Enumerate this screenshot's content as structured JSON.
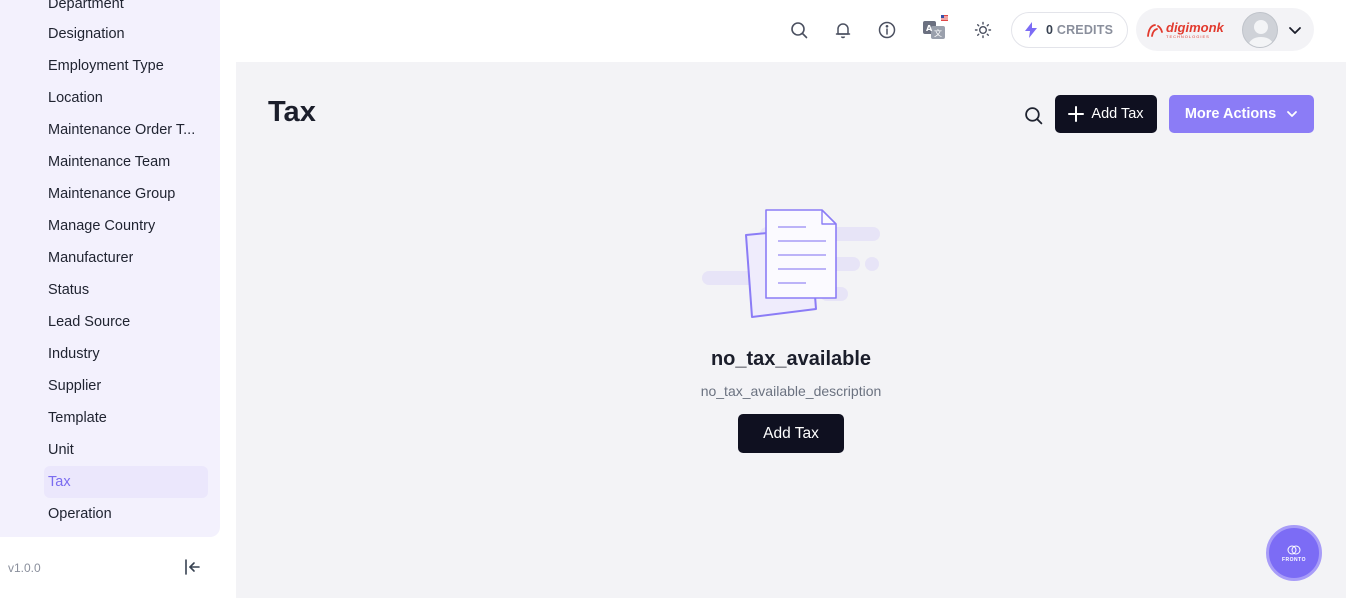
{
  "sidebar": {
    "items": [
      {
        "label": "Department"
      },
      {
        "label": "Designation"
      },
      {
        "label": "Employment Type"
      },
      {
        "label": "Location"
      },
      {
        "label": "Maintenance Order T..."
      },
      {
        "label": "Maintenance Team"
      },
      {
        "label": "Maintenance Group"
      },
      {
        "label": "Manage Country"
      },
      {
        "label": "Manufacturer"
      },
      {
        "label": "Status"
      },
      {
        "label": "Lead Source"
      },
      {
        "label": "Industry"
      },
      {
        "label": "Supplier"
      },
      {
        "label": "Template"
      },
      {
        "label": "Unit"
      },
      {
        "label": "Tax",
        "active": true
      },
      {
        "label": "Operation"
      }
    ],
    "version": "v1.0.0"
  },
  "header": {
    "icons": [
      "search-icon",
      "bell-icon",
      "info-icon",
      "translate-icon",
      "sun-icon"
    ],
    "credits": {
      "count": "0",
      "label": "CREDITS"
    },
    "brand": {
      "name": "digimonk",
      "tagline": "TECHNOLOGIES"
    }
  },
  "page": {
    "title": "Tax",
    "add_button_label": "Add Tax",
    "more_actions_label": "More Actions"
  },
  "empty_state": {
    "title": "no_tax_available",
    "description": "no_tax_available_description",
    "button_label": "Add Tax"
  },
  "fab": {
    "label": "FRONTO"
  },
  "colors": {
    "accent": "#8b7cf6",
    "dark_button": "#0f1020",
    "sidebar_bg": "#f3f1fd",
    "active_item": "#7b6cf0"
  }
}
